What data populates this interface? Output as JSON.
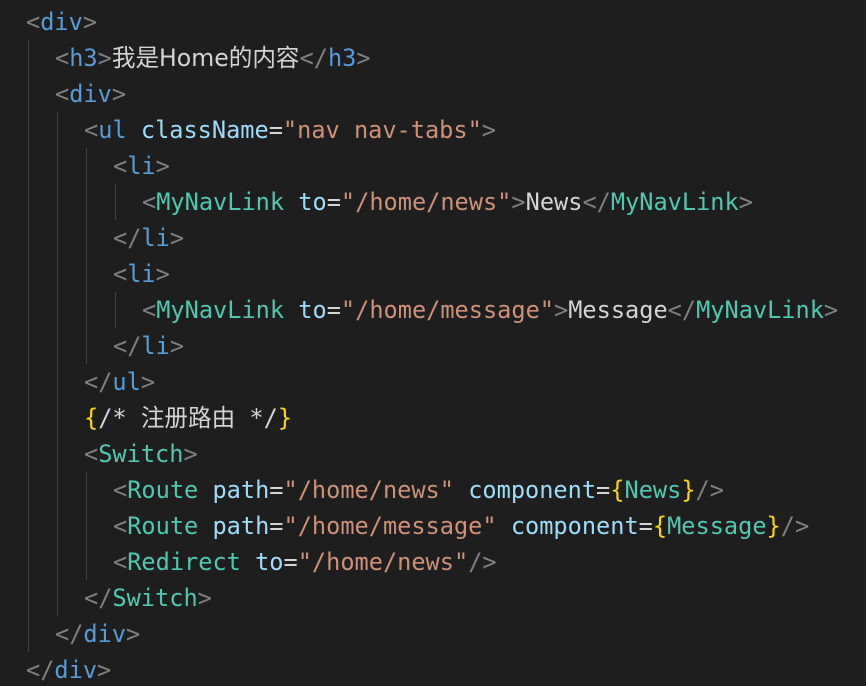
{
  "editor": {
    "lines": [
      {
        "indent": 0,
        "tokens": [
          [
            "punc",
            "<"
          ],
          [
            "tag",
            "div"
          ],
          [
            "punc",
            ">"
          ]
        ]
      },
      {
        "indent": 1,
        "tokens": [
          [
            "punc",
            "<"
          ],
          [
            "tag",
            "h3"
          ],
          [
            "punc",
            ">"
          ],
          [
            "textcn",
            "我是Home的内容"
          ],
          [
            "punc",
            "</"
          ],
          [
            "tag",
            "h3"
          ],
          [
            "punc",
            ">"
          ]
        ]
      },
      {
        "indent": 1,
        "tokens": [
          [
            "punc",
            "<"
          ],
          [
            "tag",
            "div"
          ],
          [
            "punc",
            ">"
          ]
        ]
      },
      {
        "indent": 2,
        "tokens": [
          [
            "punc",
            "<"
          ],
          [
            "tag",
            "ul"
          ],
          [
            "text",
            " "
          ],
          [
            "attr",
            "className"
          ],
          [
            "eq",
            "="
          ],
          [
            "str",
            "\"nav nav-tabs\""
          ],
          [
            "punc",
            ">"
          ]
        ]
      },
      {
        "indent": 3,
        "tokens": [
          [
            "punc",
            "<"
          ],
          [
            "tag",
            "li"
          ],
          [
            "punc",
            ">"
          ]
        ]
      },
      {
        "indent": 4,
        "tokens": [
          [
            "punc",
            "<"
          ],
          [
            "comp",
            "MyNavLink"
          ],
          [
            "text",
            " "
          ],
          [
            "attr",
            "to"
          ],
          [
            "eq",
            "="
          ],
          [
            "str",
            "\"/home/news\""
          ],
          [
            "punc",
            ">"
          ],
          [
            "text",
            "News"
          ],
          [
            "punc",
            "</"
          ],
          [
            "comp",
            "MyNavLink"
          ],
          [
            "punc",
            ">"
          ]
        ]
      },
      {
        "indent": 3,
        "tokens": [
          [
            "punc",
            "</"
          ],
          [
            "tag",
            "li"
          ],
          [
            "punc",
            ">"
          ]
        ]
      },
      {
        "indent": 3,
        "tokens": [
          [
            "punc",
            "<"
          ],
          [
            "tag",
            "li"
          ],
          [
            "punc",
            ">"
          ]
        ]
      },
      {
        "indent": 4,
        "tokens": [
          [
            "punc",
            "<"
          ],
          [
            "comp",
            "MyNavLink"
          ],
          [
            "text",
            " "
          ],
          [
            "attr",
            "to"
          ],
          [
            "eq",
            "="
          ],
          [
            "str",
            "\"/home/message\""
          ],
          [
            "punc",
            ">"
          ],
          [
            "text",
            "Message"
          ],
          [
            "punc",
            "</"
          ],
          [
            "comp",
            "MyNavLink"
          ],
          [
            "punc",
            ">"
          ]
        ]
      },
      {
        "indent": 3,
        "tokens": [
          [
            "punc",
            "</"
          ],
          [
            "tag",
            "li"
          ],
          [
            "punc",
            ">"
          ]
        ]
      },
      {
        "indent": 2,
        "tokens": [
          [
            "punc",
            "</"
          ],
          [
            "tag",
            "ul"
          ],
          [
            "punc",
            ">"
          ]
        ]
      },
      {
        "indent": 2,
        "tokens": [
          [
            "brace",
            "{"
          ],
          [
            "comment",
            "/* 注册路由 */"
          ],
          [
            "brace",
            "}"
          ]
        ]
      },
      {
        "indent": 2,
        "tokens": [
          [
            "punc",
            "<"
          ],
          [
            "comp",
            "Switch"
          ],
          [
            "punc",
            ">"
          ]
        ]
      },
      {
        "indent": 3,
        "tokens": [
          [
            "punc",
            "<"
          ],
          [
            "comp",
            "Route"
          ],
          [
            "text",
            " "
          ],
          [
            "attr",
            "path"
          ],
          [
            "eq",
            "="
          ],
          [
            "str",
            "\"/home/news\""
          ],
          [
            "text",
            " "
          ],
          [
            "attr",
            "component"
          ],
          [
            "eq",
            "="
          ],
          [
            "brace",
            "{"
          ],
          [
            "comp",
            "News"
          ],
          [
            "brace",
            "}"
          ],
          [
            "punc",
            "/>"
          ]
        ]
      },
      {
        "indent": 3,
        "tokens": [
          [
            "punc",
            "<"
          ],
          [
            "comp",
            "Route"
          ],
          [
            "text",
            " "
          ],
          [
            "attr",
            "path"
          ],
          [
            "eq",
            "="
          ],
          [
            "str",
            "\"/home/message\""
          ],
          [
            "text",
            " "
          ],
          [
            "attr",
            "component"
          ],
          [
            "eq",
            "="
          ],
          [
            "brace",
            "{"
          ],
          [
            "comp",
            "Message"
          ],
          [
            "brace",
            "}"
          ],
          [
            "punc",
            "/>"
          ]
        ]
      },
      {
        "indent": 3,
        "tokens": [
          [
            "punc",
            "<"
          ],
          [
            "comp",
            "Redirect"
          ],
          [
            "text",
            " "
          ],
          [
            "attr",
            "to"
          ],
          [
            "eq",
            "="
          ],
          [
            "str",
            "\"/home/news\""
          ],
          [
            "punc",
            "/>"
          ]
        ]
      },
      {
        "indent": 2,
        "tokens": [
          [
            "punc",
            "</"
          ],
          [
            "comp",
            "Switch"
          ],
          [
            "punc",
            ">"
          ]
        ]
      },
      {
        "indent": 1,
        "tokens": [
          [
            "punc",
            "</"
          ],
          [
            "tag",
            "div"
          ],
          [
            "punc",
            ">"
          ]
        ]
      },
      {
        "indent": 0,
        "tokens": [
          [
            "punc",
            "</"
          ],
          [
            "tag",
            "div"
          ],
          [
            "punc",
            ">"
          ]
        ]
      }
    ]
  },
  "colors": {
    "background": "#1e1e1e",
    "tag": "#569cd6",
    "component": "#4ec9b0",
    "attribute": "#9cdcfe",
    "string": "#ce9178",
    "brace": "#ffd700",
    "text": "#d4d4d4",
    "punctuation": "#808080",
    "indent_guide": "#404040"
  }
}
